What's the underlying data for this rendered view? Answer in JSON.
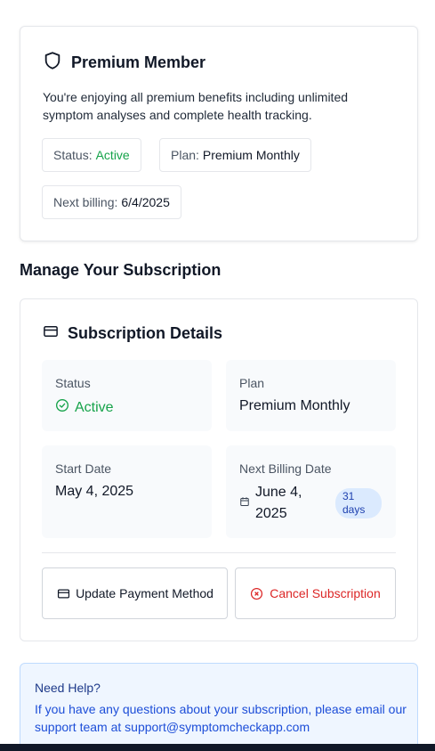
{
  "premium": {
    "title": "Premium Member",
    "description": "You're enjoying all premium benefits including unlimited symptom analyses and complete health tracking.",
    "status_label": "Status:",
    "status_value": "Active",
    "plan_label": "Plan:",
    "plan_value": "Premium Monthly",
    "billing_label": "Next billing:",
    "billing_value": "6/4/2025"
  },
  "manage": {
    "heading": "Manage Your Subscription",
    "card_title": "Subscription Details",
    "status_label": "Status",
    "status_value": "Active",
    "plan_label": "Plan",
    "plan_value": "Premium Monthly",
    "start_label": "Start Date",
    "start_value": "May 4, 2025",
    "next_label": "Next Billing Date",
    "next_value": "June 4, 2025",
    "days_badge": "31 days",
    "update_button": "Update Payment Method",
    "cancel_button": "Cancel Subscription"
  },
  "help": {
    "title": "Need Help?",
    "text": "If you have any questions about your subscription, please email our support team at support@symptomcheckapp.com"
  },
  "colors": {
    "active_green": "#16a34a",
    "cancel_red": "#dc2626",
    "help_blue": "#1d4ed8",
    "badge_bg": "#dbeafe"
  }
}
